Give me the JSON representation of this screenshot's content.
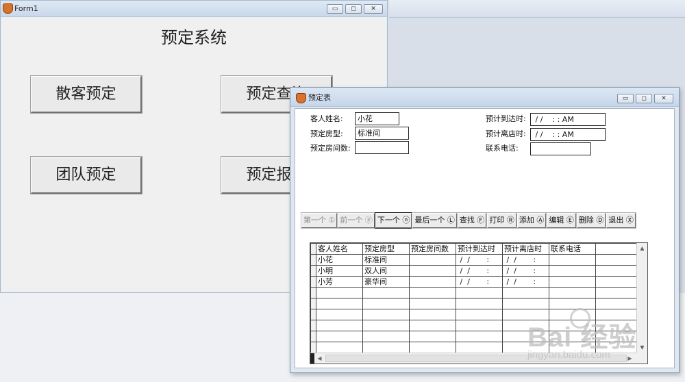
{
  "form1": {
    "window_title": "Form1",
    "heading": "预定系统",
    "buttons": {
      "walkin": "散客预定",
      "query": "预定查询",
      "group": "团队预定",
      "report": "预定报表"
    },
    "controls": {
      "minimize": "▭",
      "maximize": "◻",
      "close": "✕"
    }
  },
  "booking_form": {
    "window_title": "预定表",
    "fields": {
      "guest_name_label": "客人姓名:",
      "guest_name_value": "小花",
      "room_type_label": "预定房型:",
      "room_type_value": "标准间",
      "room_count_label": "预定房间数:",
      "room_count_value": "",
      "arrival_label": "预计到达时:",
      "arrival_value": " / /    : : AM",
      "departure_label": "预计离店时:",
      "departure_value": " / /    : : AM",
      "phone_label": "联系电话:",
      "phone_value": ""
    },
    "nav_buttons": [
      {
        "label": "第一个 ①",
        "state": "disabled"
      },
      {
        "label": "前一个 ⓟ",
        "state": "disabled"
      },
      {
        "label": "下一个 ⓝ",
        "state": "focused"
      },
      {
        "label": "最后一个 Ⓛ",
        "state": "enabled"
      },
      {
        "label": "查找 Ⓕ",
        "state": "enabled"
      },
      {
        "label": "打印 Ⓡ",
        "state": "enabled"
      },
      {
        "label": "添加 Ⓐ",
        "state": "enabled"
      },
      {
        "label": "编辑 Ⓔ",
        "state": "enabled"
      },
      {
        "label": "删除 Ⓓ",
        "state": "enabled"
      },
      {
        "label": "退出 Ⓧ",
        "state": "enabled"
      }
    ],
    "grid": {
      "columns": [
        "客人姓名",
        "预定房型",
        "预定房间数",
        "预计到达时",
        "预计离店时",
        "联系电话",
        ""
      ],
      "rows": [
        [
          "小花",
          "标准间",
          "",
          " /  /       :",
          " /  /       :",
          "",
          ""
        ],
        [
          "小明",
          "双人间",
          "",
          " /  /       :",
          " /  /       :",
          "",
          ""
        ],
        [
          "小芳",
          "豪华间",
          "",
          " /  /       :",
          " /  /       :",
          "",
          ""
        ]
      ],
      "empty_rows": 6
    }
  },
  "watermark": {
    "logo": "Bai 经验",
    "url": "jingyan.baidu.com"
  }
}
